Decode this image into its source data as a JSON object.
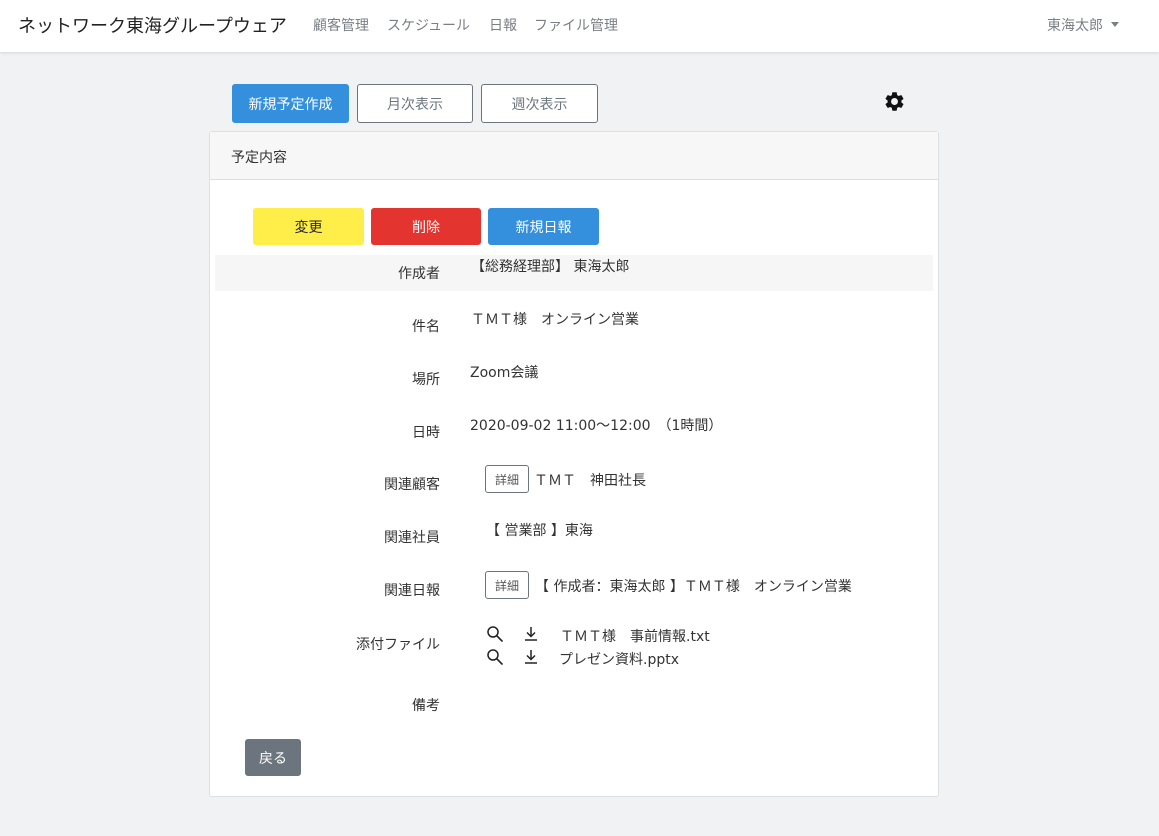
{
  "navbar": {
    "brand": "ネットワーク東海グループウェア",
    "links": [
      "顧客管理",
      "スケジュール",
      "日報",
      "ファイル管理"
    ],
    "user": "東海太郎"
  },
  "toolbar": {
    "new_schedule": "新規予定作成",
    "monthly": "月次表示",
    "weekly": "週次表示",
    "settings_icon": "gear-icon"
  },
  "card": {
    "title": "予定内容",
    "actions": {
      "edit": "変更",
      "delete": "削除",
      "new_report": "新規日報"
    },
    "fields": {
      "author": {
        "label": "作成者",
        "value": "【総務経理部】 東海太郎"
      },
      "subject": {
        "label": "件名",
        "value": "ＴＭＴ様　オンライン営業"
      },
      "place": {
        "label": "場所",
        "value": "Zoom会議"
      },
      "datetime": {
        "label": "日時",
        "value": "2020-09-02 11:00～12:00　（1時間）"
      },
      "customer": {
        "label": "関連顧客",
        "detail": "詳細",
        "value": "ＴＭＴ　神田社長"
      },
      "employee": {
        "label": "関連社員",
        "value": "【 営業部 】東海"
      },
      "report": {
        "label": "関連日報",
        "detail": "詳細",
        "value": "【 作成者：東海太郎 】ＴＭＴ様　オンライン営業"
      },
      "attachments": {
        "label": "添付ファイル",
        "files": [
          "ＴＭＴ様　事前情報.txt",
          "プレゼン資料.pptx"
        ]
      },
      "notes": {
        "label": "備考",
        "value": ""
      }
    },
    "back": "戻る"
  },
  "colors": {
    "primary": "#3490dc",
    "warning": "#ffed4a",
    "danger": "#e3342f",
    "secondary": "#6c757d"
  }
}
